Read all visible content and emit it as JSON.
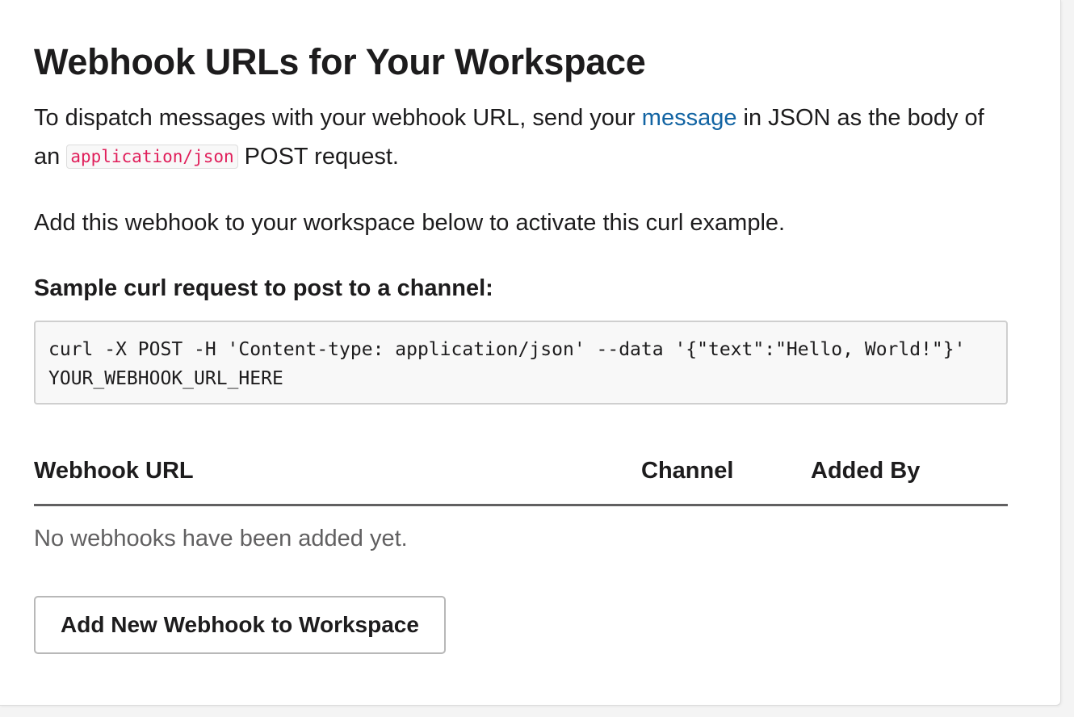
{
  "page": {
    "title": "Webhook URLs for Your Workspace"
  },
  "intro": {
    "text_before_link": "To dispatch messages with your webhook URL, send your ",
    "link_label": "message",
    "text_after_link": " in JSON as the body of an ",
    "inline_code": "application/json",
    "text_end": " POST request."
  },
  "activate_note": "Add this webhook to your workspace below to activate this curl example.",
  "sample": {
    "heading": "Sample curl request to post to a channel:",
    "code": "curl -X POST -H 'Content-type: application/json' --data '{\"text\":\"Hello, World!\"}' YOUR_WEBHOOK_URL_HERE"
  },
  "webhooks_table": {
    "columns": [
      "Webhook URL",
      "Channel",
      "Added By"
    ],
    "empty_message": "No webhooks have been added yet."
  },
  "actions": {
    "add_button_label": "Add New Webhook to Workspace"
  },
  "colors": {
    "link": "#1264a3",
    "inline_code": "#e01e5a",
    "text": "#1d1c1d",
    "muted": "#616061"
  }
}
